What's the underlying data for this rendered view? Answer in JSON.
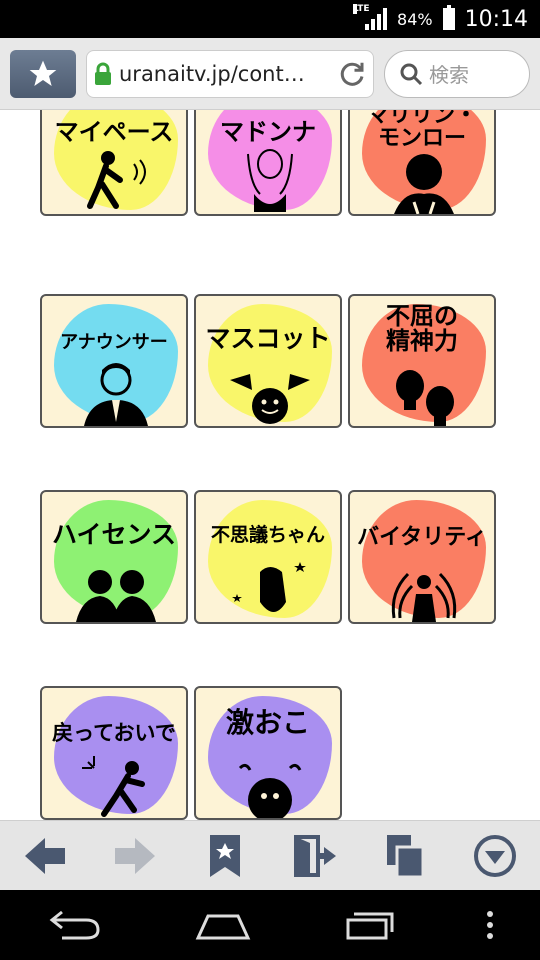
{
  "status": {
    "network": "LTE",
    "battery": "84%",
    "time": "10:14"
  },
  "browser": {
    "url": "uranaitv.jp/cont…",
    "search_placeholder": "検索"
  },
  "tiles": [
    {
      "label": "マイペース",
      "color": "#f9f66a"
    },
    {
      "label": "マドンナ",
      "color": "#f58ee7"
    },
    {
      "label": "マリリン・\nモンロー",
      "color": "#fa7e63"
    },
    {
      "label": "アナウンサー",
      "color": "#74dcf0"
    },
    {
      "label": "マスコット",
      "color": "#f9f66a"
    },
    {
      "label": "不屈の\n精神力",
      "color": "#fa7e63"
    },
    {
      "label": "ハイセンス",
      "color": "#8ef173"
    },
    {
      "label": "不思議ちゃん",
      "color": "#f9f66a"
    },
    {
      "label": "バイタリティ",
      "color": "#fa7e63"
    },
    {
      "label": "戻っておいで",
      "color": "#a98ff0"
    },
    {
      "label": "激おこ",
      "color": "#a98ff0"
    }
  ],
  "colors": {
    "icon": "#4a5870",
    "disabled": "#b5b9c0"
  }
}
